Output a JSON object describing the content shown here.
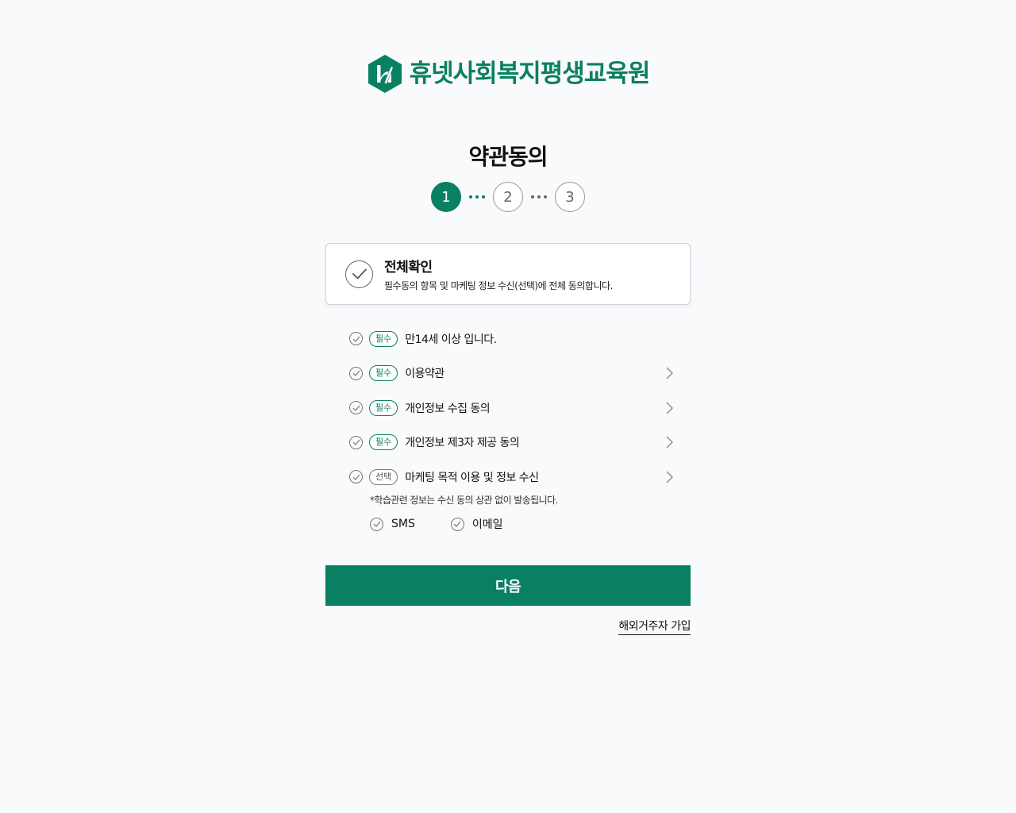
{
  "brand": {
    "name": "휴넷사회복지평생교육원",
    "color": "#0a8062",
    "logo_icon": "hunet-hexagon-logo"
  },
  "page": {
    "title": "약관동의"
  },
  "steps": [
    {
      "label": "1",
      "active": true
    },
    {
      "label": "2",
      "active": false
    },
    {
      "label": "3",
      "active": false
    }
  ],
  "agree_all": {
    "title": "전체확인",
    "description": "필수동의 항목 및 마케팅 정보 수신(선택)에 전체 동의합니다."
  },
  "agreements": [
    {
      "badge": "필수",
      "label": "만14세 이상 입니다.",
      "has_detail": false
    },
    {
      "badge": "필수",
      "label": "이용약관",
      "has_detail": true
    },
    {
      "badge": "필수",
      "label": "개인정보 수집 동의",
      "has_detail": true
    },
    {
      "badge": "필수",
      "label": "개인정보 제3자 제공 동의",
      "has_detail": true
    },
    {
      "badge": "선택",
      "label": "마케팅 목적 이용 및 정보 수신",
      "has_detail": true
    }
  ],
  "marketing": {
    "note": "*학습관련 정보는 수신 동의 상관 없이 발송됩니다.",
    "channels": [
      {
        "label": "SMS"
      },
      {
        "label": "이메일"
      }
    ]
  },
  "actions": {
    "next_label": "다음",
    "overseas_label": "해외거주자 가입"
  }
}
